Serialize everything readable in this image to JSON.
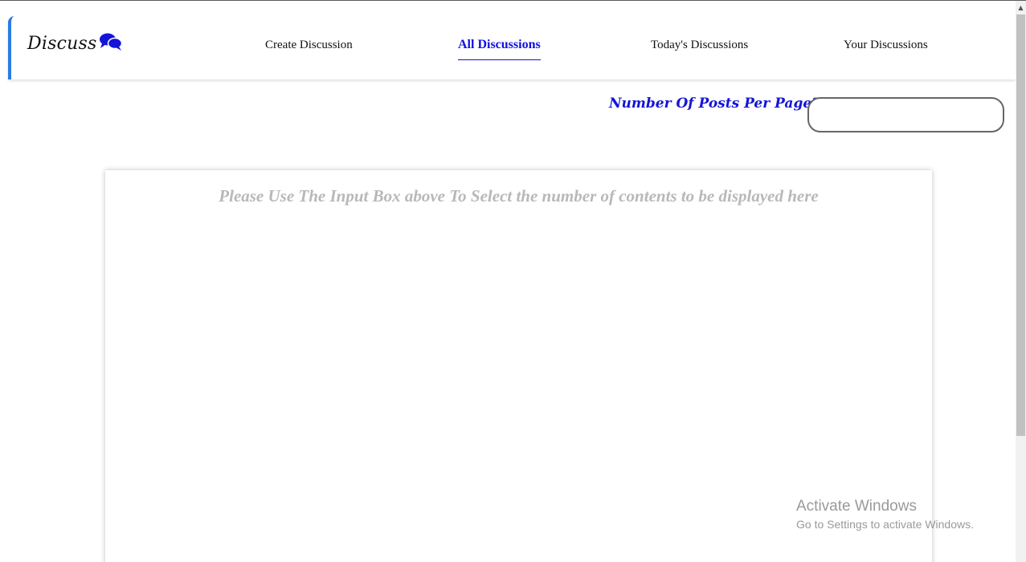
{
  "header": {
    "brand": "Discuss",
    "brand_icon": "comments-icon",
    "nav": [
      {
        "label": "Create Discussion",
        "active": false
      },
      {
        "label": "All Discussions",
        "active": true
      },
      {
        "label": "Today's Discussions",
        "active": false
      },
      {
        "label": "Your Discussions",
        "active": false
      }
    ]
  },
  "posts_per_page": {
    "label": "Number Of Posts Per Page?",
    "value": ""
  },
  "content": {
    "placeholder": "Please Use The Input Box above To Select the number of contents to be displayed here"
  },
  "watermark": {
    "title": "Activate Windows",
    "subtitle": "Go to Settings to activate Windows."
  },
  "colors": {
    "accent": "#1010e0",
    "nav_border": "#2a7de1",
    "placeholder_text": "#b8b8b8"
  }
}
